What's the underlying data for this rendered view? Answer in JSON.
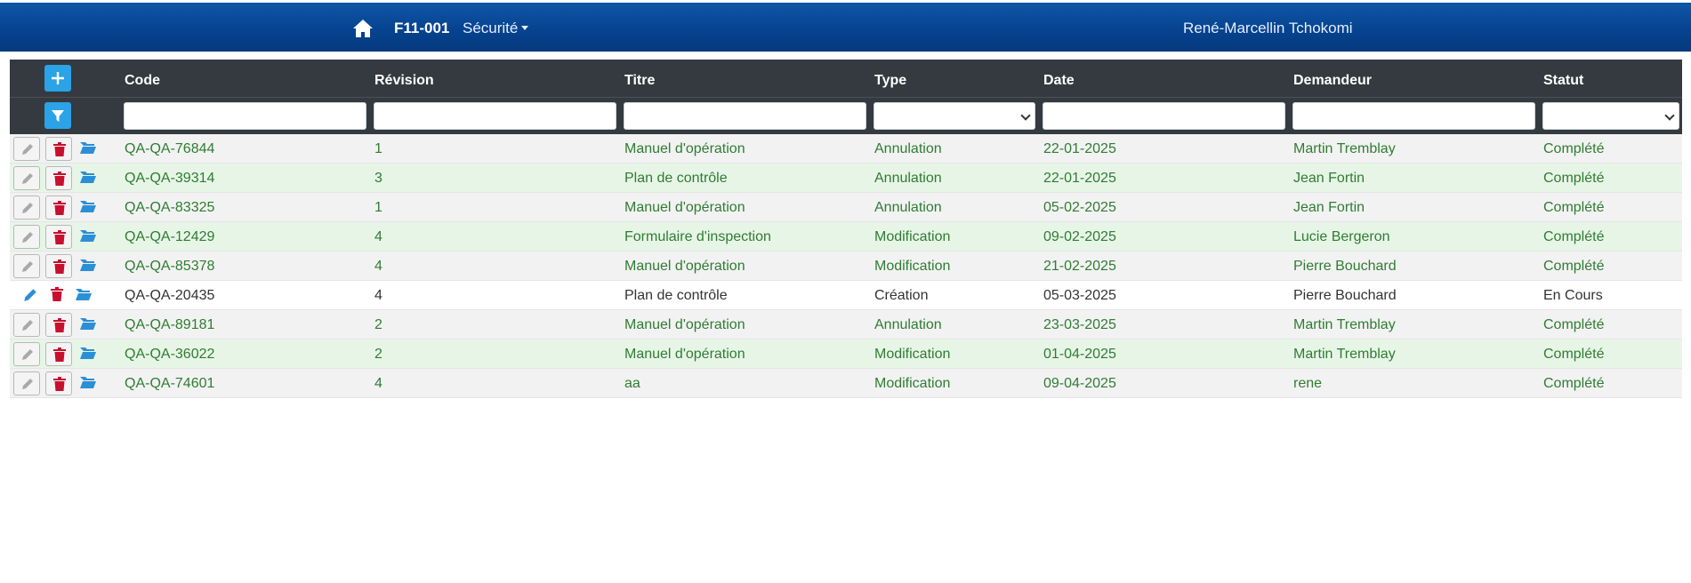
{
  "nav": {
    "home_icon": "home-icon",
    "code": "F11-001",
    "menu_label": "Sécurité",
    "user": "René-Marcellin Tchokomi"
  },
  "table": {
    "headers": [
      "Code",
      "Révision",
      "Titre",
      "Type",
      "Date",
      "Demandeur",
      "Statut"
    ],
    "rows": [
      {
        "code": "QA-QA-76844",
        "revision": "1",
        "titre": "Manuel d'opération",
        "type": "Annulation",
        "date": "22-01-2025",
        "demandeur": "Martin Tremblay",
        "statut": "Complété",
        "style": "gray",
        "editable": false
      },
      {
        "code": "QA-QA-39314",
        "revision": "3",
        "titre": "Plan de contrôle",
        "type": "Annulation",
        "date": "22-01-2025",
        "demandeur": "Jean Fortin",
        "statut": "Complété",
        "style": "green",
        "editable": false
      },
      {
        "code": "QA-QA-83325",
        "revision": "1",
        "titre": "Manuel d'opération",
        "type": "Annulation",
        "date": "05-02-2025",
        "demandeur": "Jean Fortin",
        "statut": "Complété",
        "style": "gray",
        "editable": false
      },
      {
        "code": "QA-QA-12429",
        "revision": "4",
        "titre": "Formulaire d'inspection",
        "type": "Modification",
        "date": "09-02-2025",
        "demandeur": "Lucie Bergeron",
        "statut": "Complété",
        "style": "green",
        "editable": false
      },
      {
        "code": "QA-QA-85378",
        "revision": "4",
        "titre": "Manuel d'opération",
        "type": "Modification",
        "date": "21-02-2025",
        "demandeur": "Pierre Bouchard",
        "statut": "Complété",
        "style": "gray",
        "editable": false
      },
      {
        "code": "QA-QA-20435",
        "revision": "4",
        "titre": "Plan de contrôle",
        "type": "Création",
        "date": "05-03-2025",
        "demandeur": "Pierre Bouchard",
        "statut": "En Cours",
        "style": "white",
        "editable": true
      },
      {
        "code": "QA-QA-89181",
        "revision": "2",
        "titre": "Manuel d'opération",
        "type": "Annulation",
        "date": "23-03-2025",
        "demandeur": "Martin Tremblay",
        "statut": "Complété",
        "style": "gray",
        "editable": false
      },
      {
        "code": "QA-QA-36022",
        "revision": "2",
        "titre": "Manuel d'opération",
        "type": "Modification",
        "date": "01-04-2025",
        "demandeur": "Martin Tremblay",
        "statut": "Complété",
        "style": "green",
        "editable": false
      },
      {
        "code": "QA-QA-74601",
        "revision": "4",
        "titre": "aa",
        "type": "Modification",
        "date": "09-04-2025",
        "demandeur": "rene",
        "statut": "Complété",
        "style": "gray",
        "editable": false
      }
    ]
  },
  "colors": {
    "navbar": "#064390",
    "header": "#343a40",
    "accent": "#2ba3e6",
    "delete": "#c8102e",
    "completed_text": "#2f7d32",
    "row_gray": "#f2f2f2",
    "row_green": "#e7f5e7"
  }
}
